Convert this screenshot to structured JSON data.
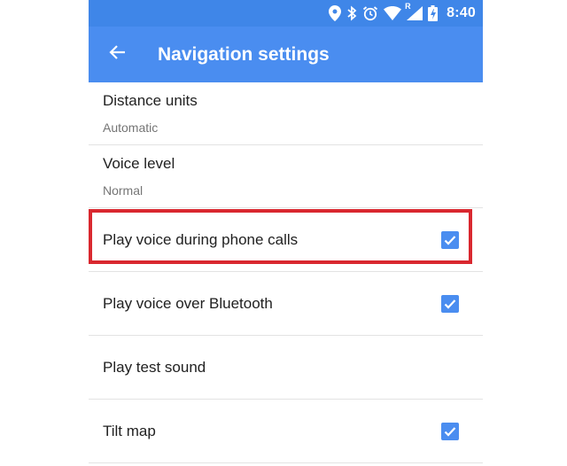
{
  "status_bar": {
    "time": "8:40",
    "icons": [
      "location-icon",
      "bluetooth-icon",
      "alarm-icon",
      "wifi-icon",
      "signal-roaming-icon",
      "battery-charging-icon"
    ],
    "roaming_mark": "R"
  },
  "app_bar": {
    "title": "Navigation settings",
    "back_icon": "back-arrow-icon"
  },
  "settings": {
    "distance_units": {
      "label": "Distance units",
      "value": "Automatic"
    },
    "voice_level": {
      "label": "Voice level",
      "value": "Normal"
    },
    "play_voice_calls": {
      "label": "Play voice during phone calls",
      "checked": true
    },
    "play_voice_bluetooth": {
      "label": "Play voice over Bluetooth",
      "checked": true
    },
    "play_test_sound": {
      "label": "Play test sound"
    },
    "tilt_map": {
      "label": "Tilt map",
      "checked": true
    }
  },
  "colors": {
    "app_bar": "#4a8df0",
    "status_bar": "#3f86e8",
    "checkbox": "#4a8df0",
    "highlight_box": "#d9282f"
  }
}
